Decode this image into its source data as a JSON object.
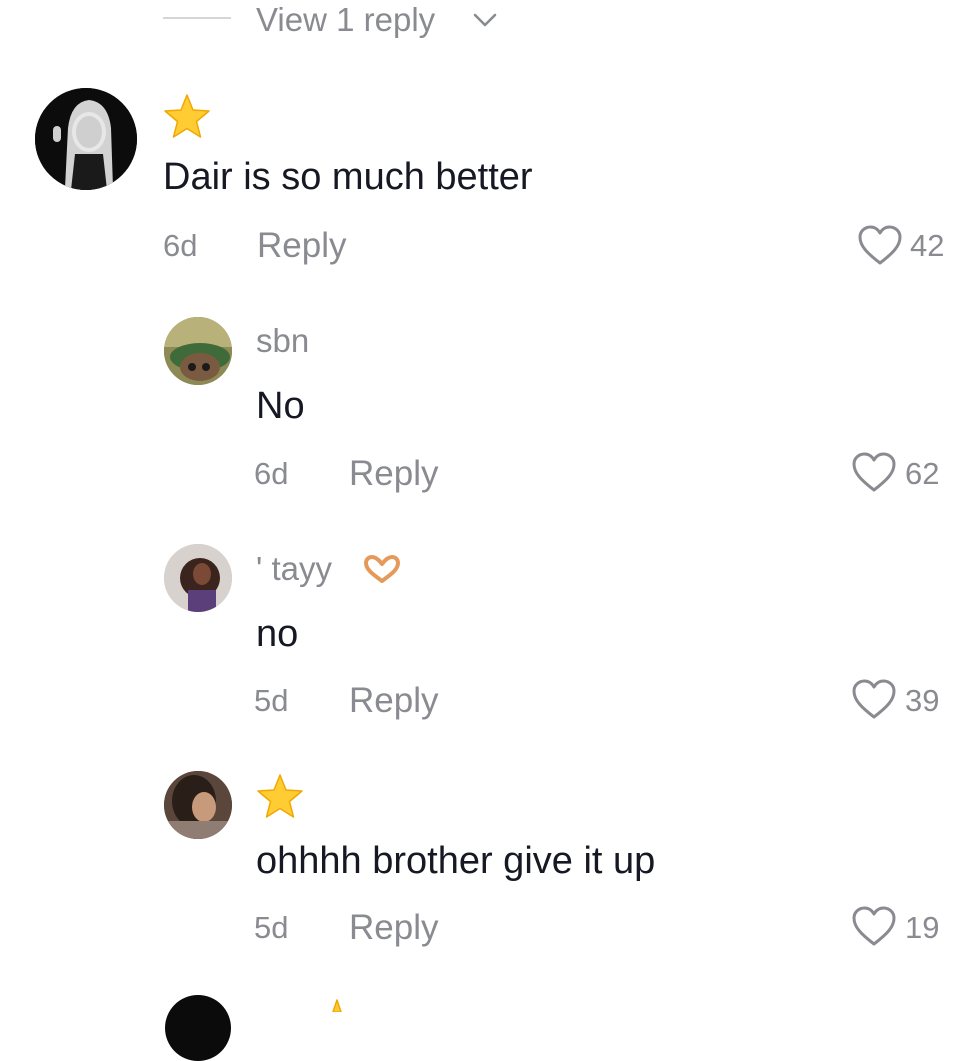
{
  "view_replies": {
    "label": "View 1 reply",
    "chevron_icon": "chevron-down-icon"
  },
  "comments": [
    {
      "username": "",
      "username_icon": "star-icon",
      "text": "Dair is so much better",
      "time": "6d",
      "reply_label": "Reply",
      "likes": "42"
    },
    {
      "username": "sbn",
      "text": "No",
      "time": "6d",
      "reply_label": "Reply",
      "likes": "62"
    },
    {
      "username": "' tayy",
      "username_icon": "heart-hands-icon",
      "text": "no",
      "time": "5d",
      "reply_label": "Reply",
      "likes": "39"
    },
    {
      "username": "",
      "username_icon": "star-icon",
      "text": "ohhhh brother give it up",
      "time": "5d",
      "reply_label": "Reply",
      "likes": "19"
    }
  ],
  "colors": {
    "text_primary": "#161823",
    "text_secondary": "#8a8b91",
    "star": "#ffcc33"
  }
}
